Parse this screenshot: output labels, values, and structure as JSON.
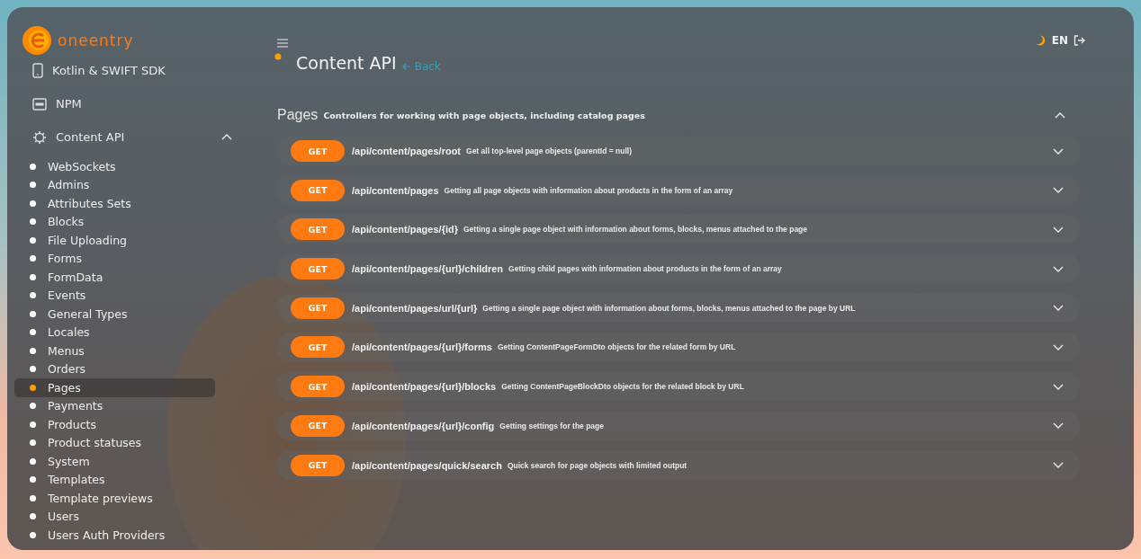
{
  "brand": {
    "name": "oneentry"
  },
  "sidebar": {
    "items": [
      {
        "kind": "phone",
        "label": "Kotlin & SWIFT SDK"
      },
      {
        "kind": "npm",
        "label": "NPM"
      },
      {
        "kind": "gear",
        "label": "Content API",
        "expanded": true,
        "children": [
          {
            "label": "WebSockets",
            "selected": false
          },
          {
            "label": "Admins",
            "selected": false
          },
          {
            "label": "Attributes Sets",
            "selected": false
          },
          {
            "label": "Blocks",
            "selected": false
          },
          {
            "label": "File Uploading",
            "selected": false
          },
          {
            "label": "Forms",
            "selected": false
          },
          {
            "label": "FormData",
            "selected": false
          },
          {
            "label": "Events",
            "selected": false
          },
          {
            "label": "General Types",
            "selected": false
          },
          {
            "label": "Locales",
            "selected": false
          },
          {
            "label": "Menus",
            "selected": false
          },
          {
            "label": "Orders",
            "selected": false
          },
          {
            "label": "Pages",
            "selected": true
          },
          {
            "label": "Payments",
            "selected": false
          },
          {
            "label": "Products",
            "selected": false
          },
          {
            "label": "Product statuses",
            "selected": false
          },
          {
            "label": "System",
            "selected": false
          },
          {
            "label": "Templates",
            "selected": false
          },
          {
            "label": "Template previews",
            "selected": false
          },
          {
            "label": "Users",
            "selected": false
          },
          {
            "label": "Users Auth Providers",
            "selected": false
          }
        ]
      }
    ]
  },
  "header": {
    "title": "Content API",
    "back": "Back",
    "language": "EN"
  },
  "section": {
    "title": "Pages",
    "description": "Controllers for working with page objects, including catalog pages",
    "expanded": true,
    "endpoints": [
      {
        "method": "GET",
        "path": "/api/content/pages/root",
        "description": "Get all top-level page objects (parentId = null)",
        "expanded": false
      },
      {
        "method": "GET",
        "path": "/api/content/pages",
        "description": "Getting all page objects with information about products in the form of an array",
        "expanded": false
      },
      {
        "method": "GET",
        "path": "/api/content/pages/{id}",
        "description": "Getting a single page object with information about forms, blocks, menus attached to the page",
        "expanded": false
      },
      {
        "method": "GET",
        "path": "/api/content/pages/{url}/children",
        "description": "Getting child pages with information about products in the form of an array",
        "expanded": false
      },
      {
        "method": "GET",
        "path": "/api/content/pages/url/{url}",
        "description": "Getting a single page object with information about forms, blocks, menus attached to the page by URL",
        "expanded": false
      },
      {
        "method": "GET",
        "path": "/api/content/pages/{url}/forms",
        "description": "Getting ContentPageFormDto objects for the related form by URL",
        "expanded": false
      },
      {
        "method": "GET",
        "path": "/api/content/pages/{url}/blocks",
        "description": "Getting ContentPageBlockDto objects for the related block by URL",
        "expanded": false
      },
      {
        "method": "GET",
        "path": "/api/content/pages/{url}/config",
        "description": "Getting settings for the page",
        "expanded": false
      },
      {
        "method": "GET",
        "path": "/api/content/pages/quick/search",
        "description": "Quick search for page objects with limited output",
        "expanded": false
      }
    ]
  }
}
